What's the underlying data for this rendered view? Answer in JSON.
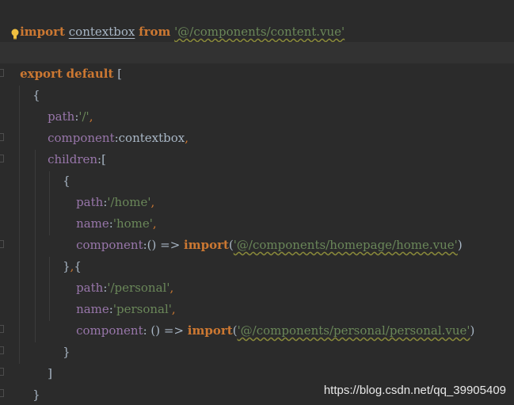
{
  "code": {
    "line1": {
      "import_kw": "import",
      "ident": "contextbox",
      "from_kw": "from",
      "path": "'@/components/content.vue'"
    },
    "line3": {
      "export_kw": "export",
      "default_kw": "default",
      "bracket": "["
    },
    "line4": {
      "brace": "{"
    },
    "line5": {
      "key": "path",
      "colon": ":",
      "value": "'/'",
      "comma": ","
    },
    "line6": {
      "key": "component",
      "colon": ":",
      "value": "contextbox",
      "comma": ","
    },
    "line7": {
      "key": "children",
      "colon": ":",
      "bracket": "["
    },
    "line8": {
      "brace": "{"
    },
    "line9": {
      "key": "path",
      "colon": ":",
      "value": "'/home'",
      "comma": ","
    },
    "line10": {
      "key": "name",
      "colon": ":",
      "value": "'home'",
      "comma": ","
    },
    "line11": {
      "key": "component",
      "rest": ":() => ",
      "import_kw": "import",
      "open": "(",
      "path": "'@/components/homepage/home.vue'",
      "close": ")"
    },
    "line12": {
      "close_brace": "}",
      "comma": ",",
      "open_brace": "{"
    },
    "line13": {
      "key": "path",
      "colon": ":",
      "value": "'/personal'",
      "comma": ","
    },
    "line14": {
      "key": "name",
      "colon": ":",
      "value": "'personal'",
      "comma": ","
    },
    "line15": {
      "key": "component",
      "rest": ": () => ",
      "import_kw": "import",
      "open": "(",
      "path": "'@/components/personal/personal.vue'",
      "close": ")"
    },
    "line16": {
      "brace": "}"
    },
    "line17": {
      "bracket": "]"
    },
    "line18": {
      "brace": "}"
    },
    "line19": {
      "bracket": "]"
    }
  },
  "watermark": "https://blog.csdn.net/qq_39905409",
  "colors": {
    "background": "#2b2b2b",
    "keyword": "#cc7832",
    "property": "#9876aa",
    "string": "#6a8759",
    "text": "#a9b7c6"
  },
  "icons": {
    "intention": "lightbulb-icon",
    "fold": "fold-marker-icon"
  }
}
